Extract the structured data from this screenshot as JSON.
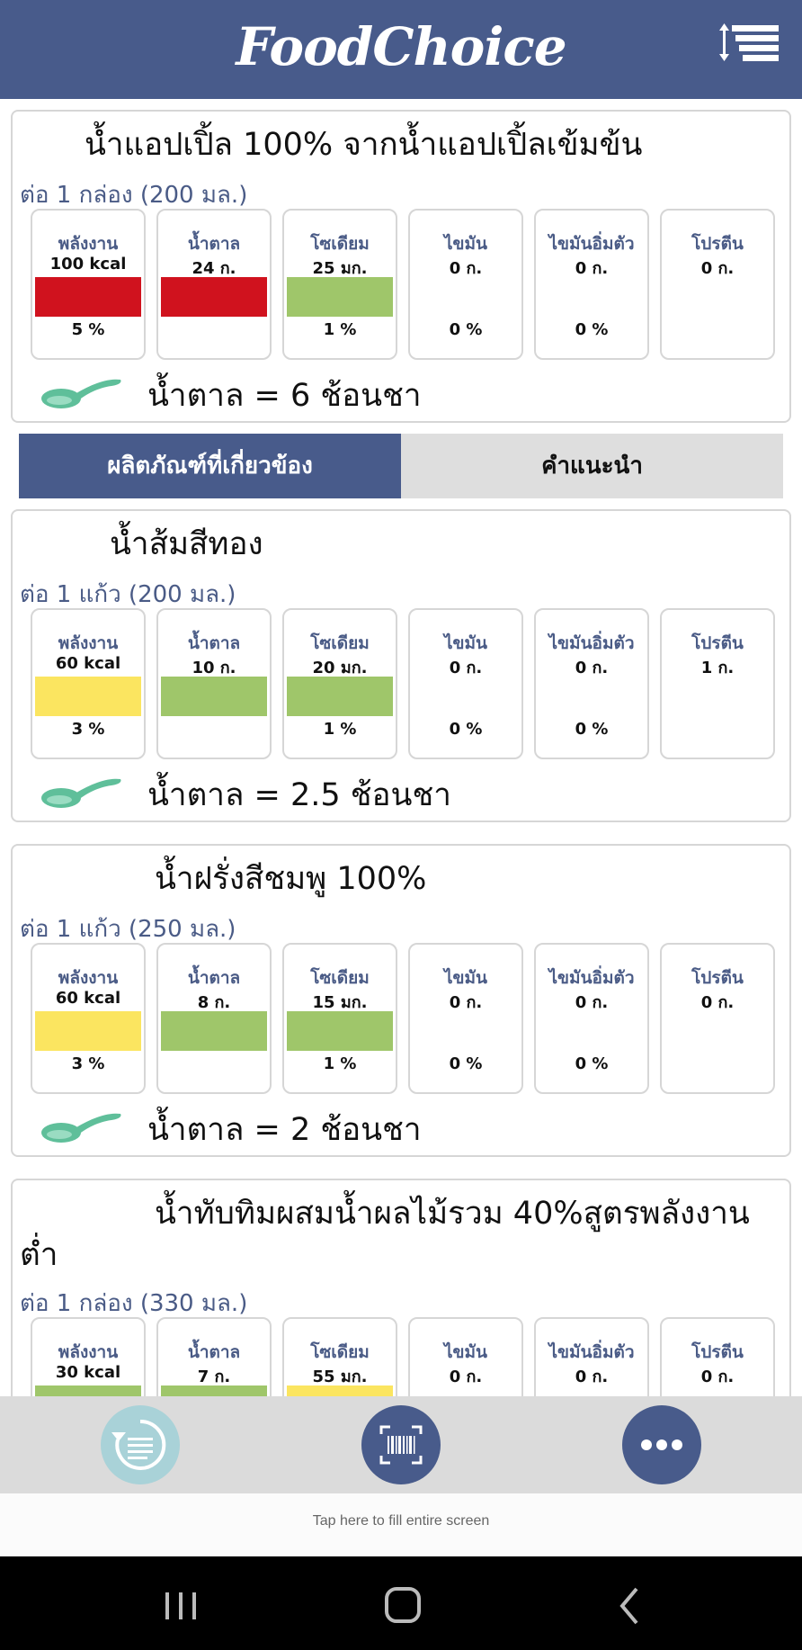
{
  "app": {
    "title": "FoodChoice"
  },
  "products": [
    {
      "name": "น้ำแอปเปิ้ล 100% จากน้ำแอปเปิ้ลเข้มข้น",
      "serving": "ต่อ 1 กล่อง (200 มล.)",
      "sugar_label": "น้ำตาล = 6 ช้อนชา",
      "nutrients": [
        {
          "label": "พลังงาน",
          "amount": "100 kcal",
          "color": "#d0121e",
          "percent": "5 %"
        },
        {
          "label": "น้ำตาล",
          "amount": "24 ก.",
          "color": "#d0121e",
          "percent": ""
        },
        {
          "label": "โซเดียม",
          "amount": "25 มก.",
          "color": "#9fc66a",
          "percent": "1 %"
        },
        {
          "label": "ไขมัน",
          "amount": "0 ก.",
          "color": "",
          "percent": "0 %"
        },
        {
          "label": "ไขมันอิ่มตัว",
          "amount": "0 ก.",
          "color": "",
          "percent": "0 %"
        },
        {
          "label": "โปรตีน",
          "amount": "0 ก.",
          "color": "",
          "percent": ""
        }
      ]
    },
    {
      "name": "น้ำส้มสีทอง",
      "serving": "ต่อ 1 แก้ว (200 มล.)",
      "sugar_label": "น้ำตาล = 2.5 ช้อนชา",
      "nutrients": [
        {
          "label": "พลังงาน",
          "amount": "60 kcal",
          "color": "#fbe560",
          "percent": "3 %"
        },
        {
          "label": "น้ำตาล",
          "amount": "10 ก.",
          "color": "#9fc66a",
          "percent": ""
        },
        {
          "label": "โซเดียม",
          "amount": "20 มก.",
          "color": "#9fc66a",
          "percent": "1 %"
        },
        {
          "label": "ไขมัน",
          "amount": "0 ก.",
          "color": "",
          "percent": "0 %"
        },
        {
          "label": "ไขมันอิ่มตัว",
          "amount": "0 ก.",
          "color": "",
          "percent": "0 %"
        },
        {
          "label": "โปรตีน",
          "amount": "1 ก.",
          "color": "",
          "percent": ""
        }
      ]
    },
    {
      "name": "น้ำฝรั่งสีชมพู 100%",
      "serving": "ต่อ 1 แก้ว (250 มล.)",
      "sugar_label": "น้ำตาล = 2 ช้อนชา",
      "nutrients": [
        {
          "label": "พลังงาน",
          "amount": "60 kcal",
          "color": "#fbe560",
          "percent": "3 %"
        },
        {
          "label": "น้ำตาล",
          "amount": "8 ก.",
          "color": "#9fc66a",
          "percent": ""
        },
        {
          "label": "โซเดียม",
          "amount": "15 มก.",
          "color": "#9fc66a",
          "percent": "1 %"
        },
        {
          "label": "ไขมัน",
          "amount": "0 ก.",
          "color": "",
          "percent": "0 %"
        },
        {
          "label": "ไขมันอิ่มตัว",
          "amount": "0 ก.",
          "color": "",
          "percent": "0 %"
        },
        {
          "label": "โปรตีน",
          "amount": "0 ก.",
          "color": "",
          "percent": ""
        }
      ]
    },
    {
      "name": "น้ำทับทิมผสมน้ำผลไม้รวม 40%สูตรพลังงานต่ำ",
      "serving": "ต่อ 1 กล่อง (330 มล.)",
      "sugar_label": "",
      "nutrients": [
        {
          "label": "พลังงาน",
          "amount": "30 kcal",
          "color": "#9fc66a",
          "percent": ""
        },
        {
          "label": "น้ำตาล",
          "amount": "7 ก.",
          "color": "#9fc66a",
          "percent": ""
        },
        {
          "label": "โซเดียม",
          "amount": "55 มก.",
          "color": "#fbe560",
          "percent": ""
        },
        {
          "label": "ไขมัน",
          "amount": "0 ก.",
          "color": "",
          "percent": ""
        },
        {
          "label": "ไขมันอิ่มตัว",
          "amount": "0 ก.",
          "color": "",
          "percent": ""
        },
        {
          "label": "โปรตีน",
          "amount": "0 ก.",
          "color": "",
          "percent": ""
        }
      ]
    }
  ],
  "tabs": [
    {
      "label": "ผลิตภัณฑ์ที่เกี่ยวข้อง",
      "active": true
    },
    {
      "label": "คำแนะนำ",
      "active": false
    }
  ],
  "bottom_bar": {
    "icons": [
      "history-icon",
      "barcode-scan-icon",
      "more-icon"
    ]
  },
  "ad": {
    "text": "Tap here to fill entire screen"
  },
  "colors": {
    "header": "#485b8b",
    "red": "#d0121e",
    "yellow": "#fbe560",
    "green": "#9fc66a",
    "spoon": "#5fbf9a"
  }
}
